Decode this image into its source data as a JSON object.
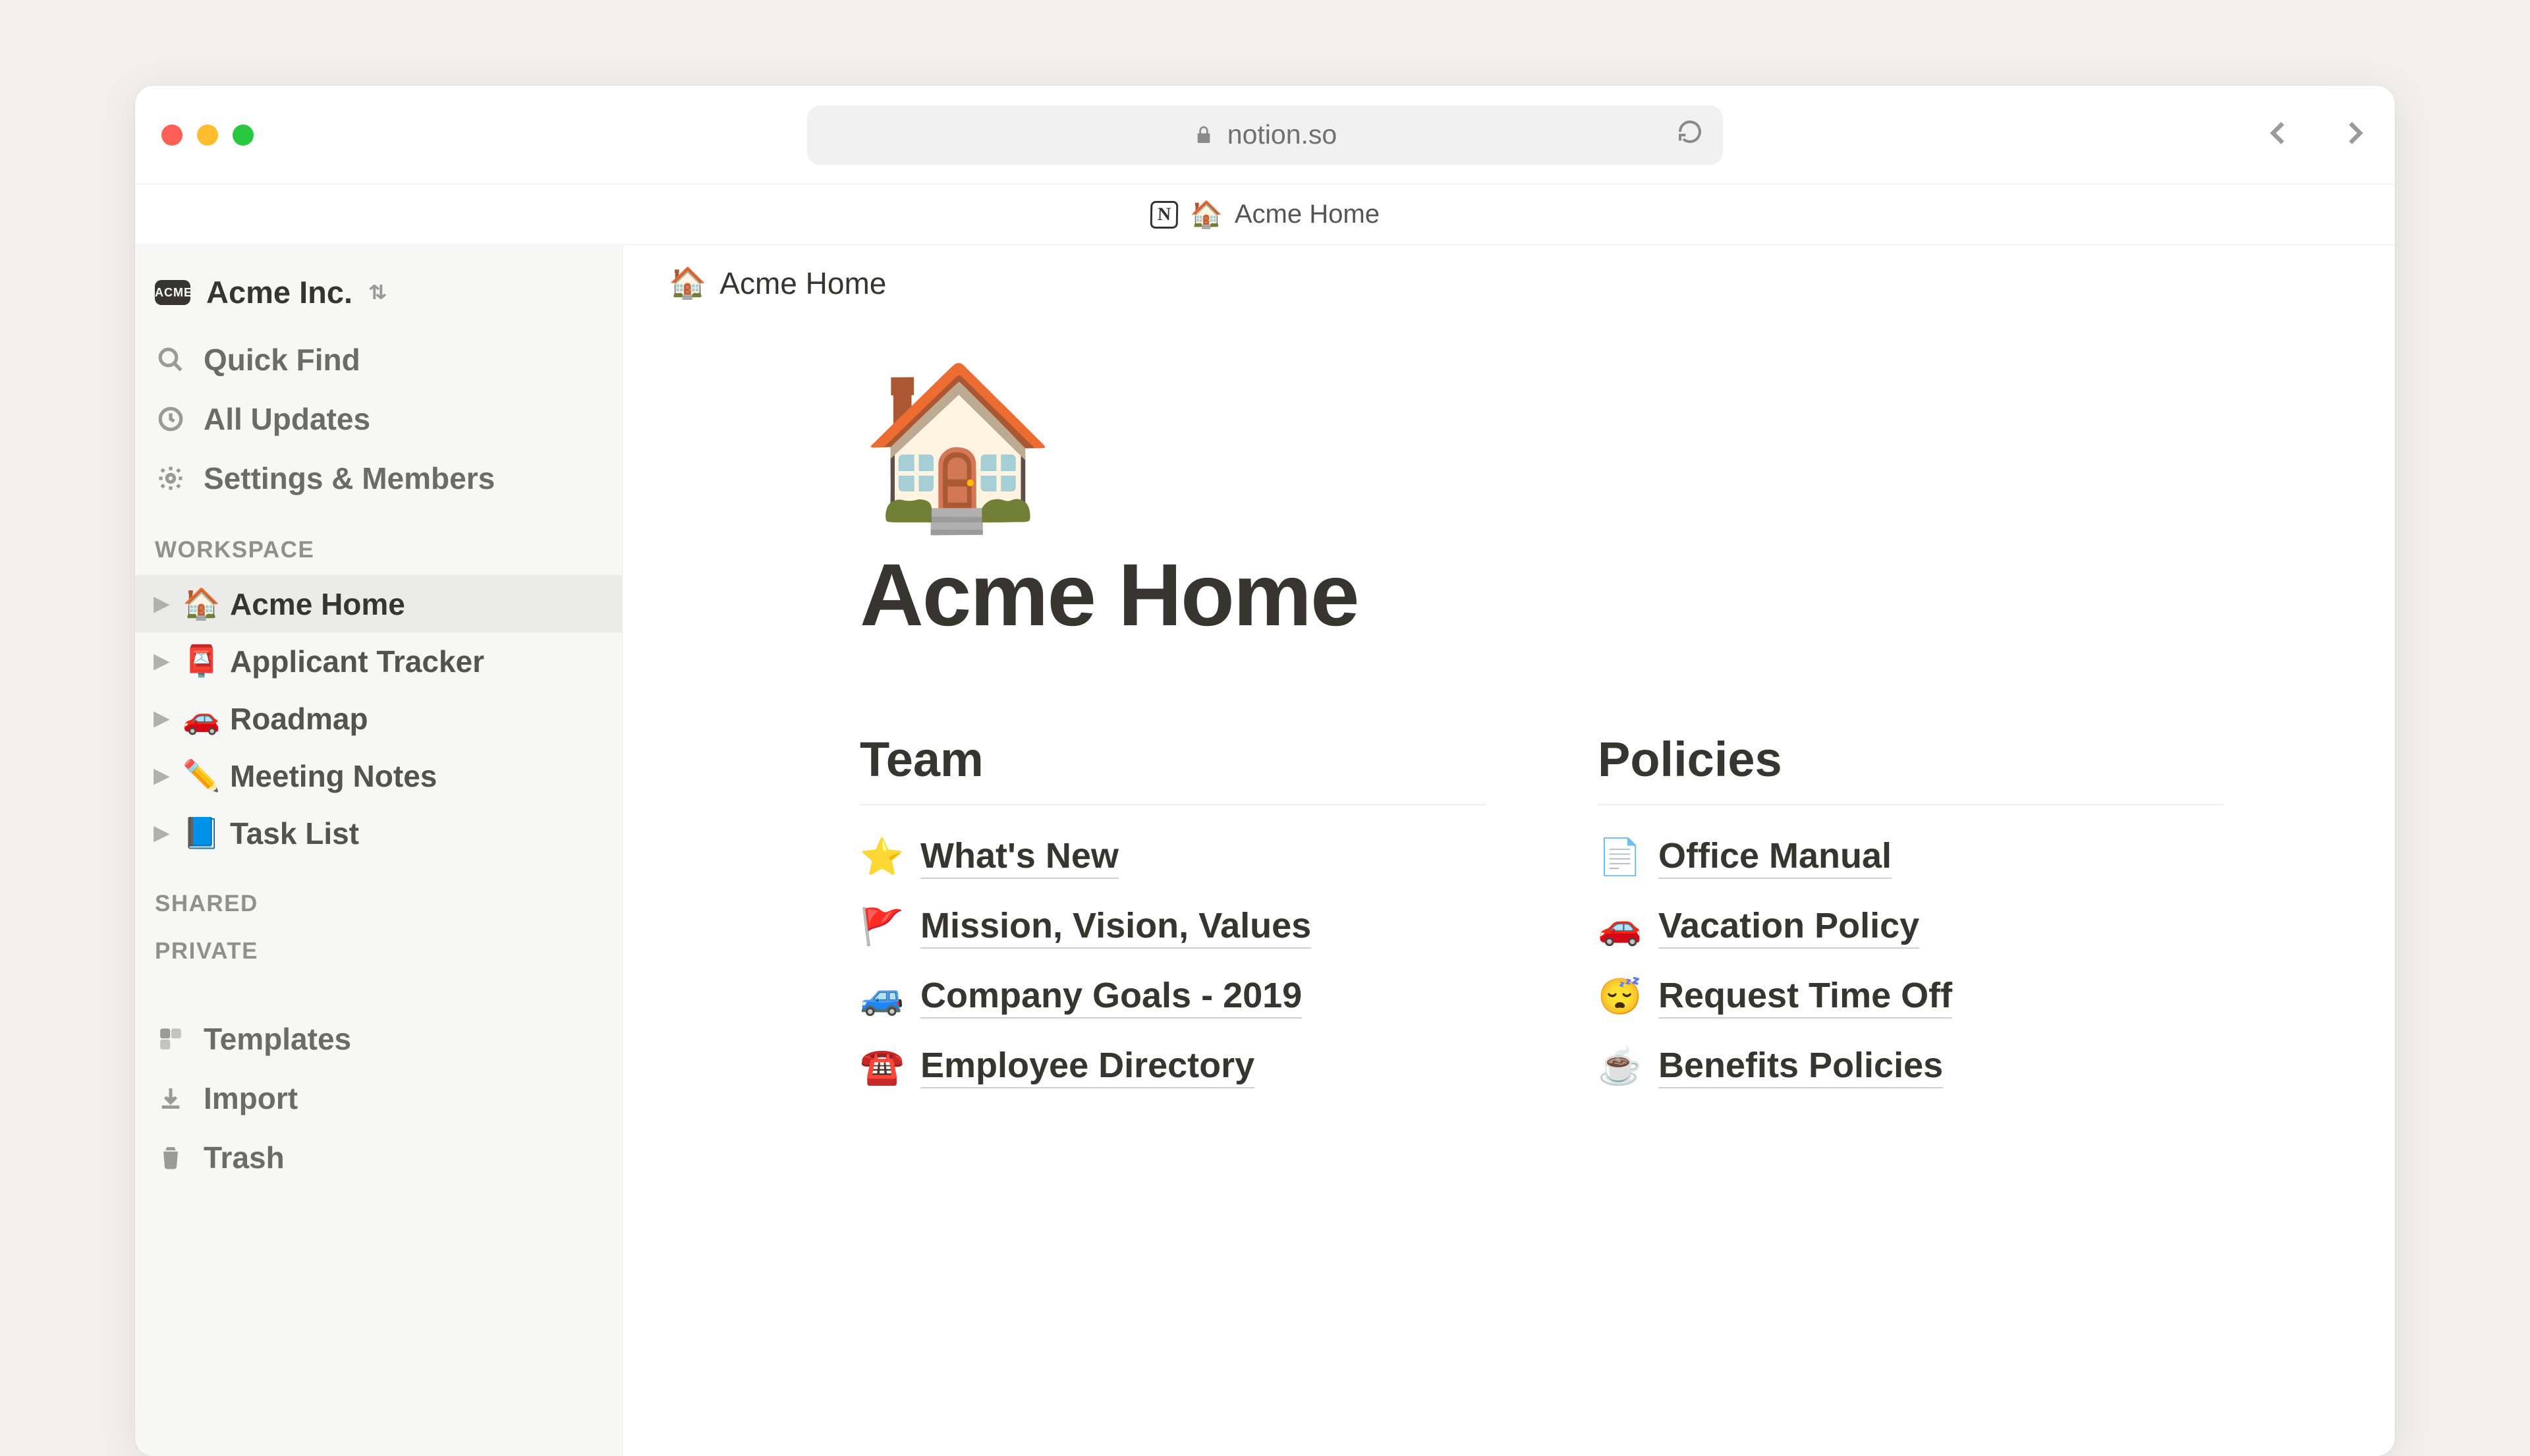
{
  "browser": {
    "url": "notion.so",
    "tab_emoji": "🏠",
    "tab_title": "Acme Home"
  },
  "workspace": {
    "name": "Acme Inc.",
    "logo_text": "ACME"
  },
  "sidebar": {
    "quick_find": "Quick Find",
    "all_updates": "All Updates",
    "settings": "Settings & Members",
    "section_workspace": "WORKSPACE",
    "section_shared": "SHARED",
    "section_private": "PRIVATE",
    "pages": [
      {
        "emoji": "🏠",
        "label": "Acme Home",
        "active": true
      },
      {
        "emoji": "📮",
        "label": "Applicant Tracker",
        "active": false
      },
      {
        "emoji": "🚗",
        "label": "Roadmap",
        "active": false
      },
      {
        "emoji": "✏️",
        "label": "Meeting Notes",
        "active": false
      },
      {
        "emoji": "📘",
        "label": "Task List",
        "active": false
      }
    ],
    "templates": "Templates",
    "import": "Import",
    "trash": "Trash"
  },
  "main": {
    "breadcrumb_emoji": "🏠",
    "breadcrumb": "Acme Home",
    "hero_emoji": "🏠",
    "title": "Acme Home",
    "team_heading": "Team",
    "policies_heading": "Policies",
    "team_links": [
      {
        "emoji": "⭐",
        "label": "What's New"
      },
      {
        "emoji": "🚩",
        "label": "Mission, Vision, Values"
      },
      {
        "emoji": "🚙",
        "label": "Company Goals - 2019"
      },
      {
        "emoji": "☎️",
        "label": "Employee Directory"
      }
    ],
    "policies_links": [
      {
        "emoji": "📄",
        "label": "Office Manual"
      },
      {
        "emoji": "🚗",
        "label": "Vacation Policy"
      },
      {
        "emoji": "😴",
        "label": "Request Time Off"
      },
      {
        "emoji": "☕",
        "label": "Benefits Policies"
      }
    ]
  }
}
